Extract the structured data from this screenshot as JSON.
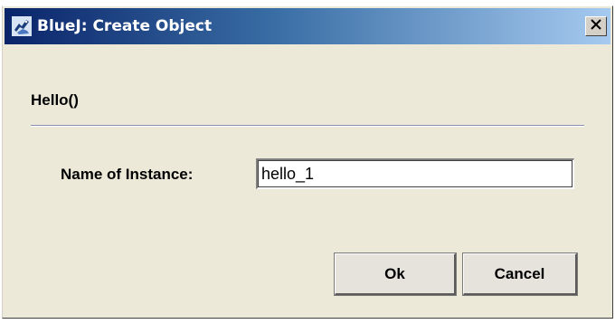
{
  "window": {
    "title": "BlueJ: Create Object",
    "app_icon": "bluej-bird-icon",
    "close_icon": "close-icon"
  },
  "dialog": {
    "method_signature": "Hello()",
    "name_label": "Name of Instance:",
    "name_value": "hello_1"
  },
  "buttons": {
    "ok_label": "Ok",
    "cancel_label": "Cancel"
  },
  "colors": {
    "titlebar_start": "#0a246a",
    "titlebar_end": "#a6caf0",
    "dialog_background": "#ece9d8"
  }
}
